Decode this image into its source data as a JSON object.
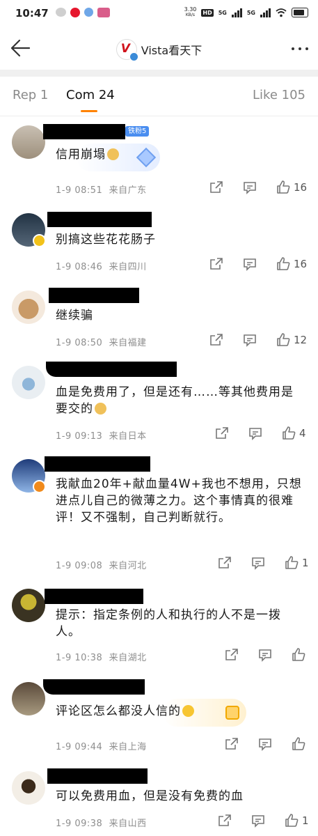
{
  "status_bar": {
    "time": "10:47",
    "speed": "3.30",
    "speed_unit": "KB/s",
    "hd": "HD",
    "net1": "5G",
    "net2": "5G"
  },
  "header": {
    "title": "Vista看天下"
  },
  "tabs": {
    "rep": "Rep 1",
    "com": "Com 24",
    "like": "Like 105"
  },
  "comments": [
    {
      "text": "信用崩塌",
      "emoji": "doge",
      "time": "1-9 08:51",
      "loc": "来自广东",
      "likes": "16",
      "fan_badge": "铁粉5",
      "decor": "blue"
    },
    {
      "text": "别搞这些花花肠子",
      "time": "1-9 08:46",
      "loc": "来自四川",
      "likes": "16"
    },
    {
      "text": "继续骗",
      "time": "1-9 08:50",
      "loc": "来自福建",
      "likes": "12"
    },
    {
      "text": "血是免费用了，但是还有……等其他费用是要交的",
      "emoji": "doge",
      "time": "1-9 09:13",
      "loc": "来自日本",
      "likes": "4"
    },
    {
      "text": "我献血20年+献血量4W+我也不想用，只想进点儿自己的微薄之力。这个事情真的很难评！又不强制，自己判断就行。",
      "time": "1-9 09:08",
      "loc": "来自河北",
      "likes": "1"
    },
    {
      "text": "提示：指定条例的人和执行的人不是一拨人。",
      "time": "1-9 10:38",
      "loc": "来自湖北",
      "likes": ""
    },
    {
      "text": "评论区怎么都没人信的",
      "emoji": "laugh",
      "time": "1-9 09:44",
      "loc": "来自上海",
      "likes": "",
      "decor": "gold"
    },
    {
      "text": "可以免费用血，但是没有免费的血",
      "time": "1-9 09:38",
      "loc": "来自山西",
      "likes": "1"
    }
  ],
  "colors": {
    "accent": "#ff8200",
    "meta_text": "#8e8e8e",
    "fan_badge": "#4a8ef0",
    "verified_orange": "#f08a1c",
    "verified_yellow": "#f2c21a"
  },
  "icons": [
    "back-arrow-icon",
    "more-icon",
    "share-icon",
    "comment-icon",
    "like-icon"
  ]
}
